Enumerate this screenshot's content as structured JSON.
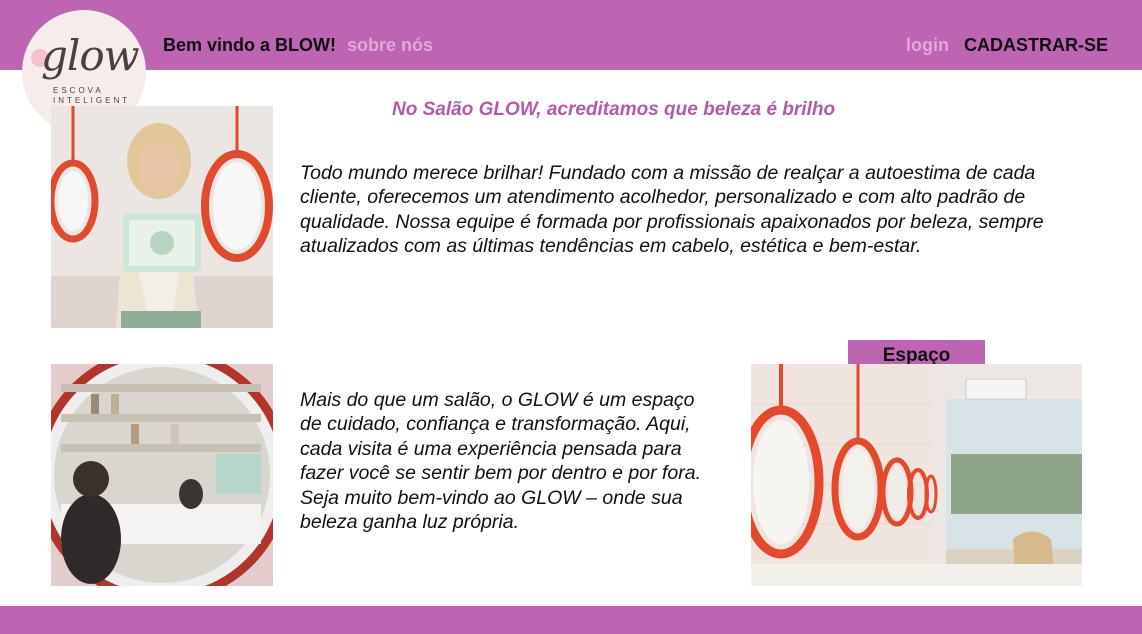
{
  "header": {
    "welcome": "Bem vindo a BLOW!",
    "about_link": "sobre nós",
    "login_link": "login",
    "register_link": "CADASTRAR-SE"
  },
  "logo": {
    "word": "glow",
    "subtitle": "ESCOVA INTELIGENT"
  },
  "main": {
    "tagline": "No Salão GLOW, acreditamos que beleza é brilho",
    "paragraph1": "Todo mundo merece brilhar! Fundado com a missão de realçar a autoestima de cada cliente, oferecemos um atendimento acolhedor, personalizado e com alto padrão de qualidade. Nossa equipe é formada por profissionais apaixonados por beleza, sempre atualizados com as últimas tendências em cabelo, estética e bem-estar.",
    "paragraph2": "Mais do que um salão, o GLOW é um espaço de cuidado, confiança e transformação. Aqui, cada visita é uma experiência pensada para fazer você se sentir bem por dentro e por fora. Seja muito bem-vindo ao GLOW – onde sua beleza ganha luz própria.",
    "space_label": "Espaço"
  },
  "colors": {
    "brand_purple": "#bd64b3",
    "accent_pink": "#b55aa8",
    "muted_link": "#e0a9d8"
  }
}
